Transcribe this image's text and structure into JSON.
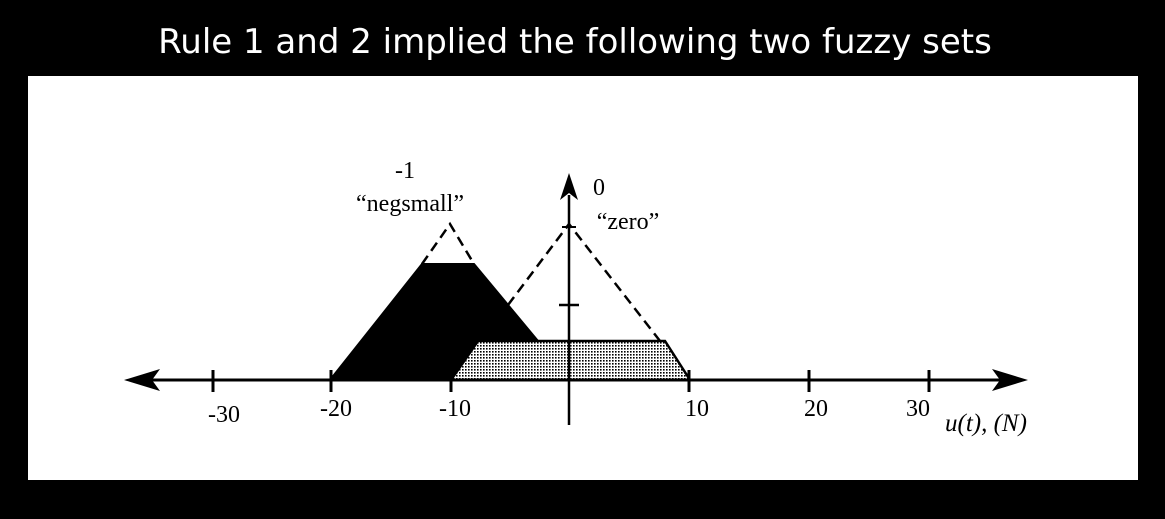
{
  "title": "Rule 1 and 2 implied the following two fuzzy sets",
  "diagram": {
    "axis_label": "u(t), (N)",
    "ticks": [
      "-30",
      "-20",
      "-10",
      "10",
      "20",
      "30"
    ],
    "sets": [
      {
        "index": "-1",
        "name": "“negsmall”",
        "center": -10,
        "clip_level": 0.75,
        "fill": "black"
      },
      {
        "index": "0",
        "name": "“zero”",
        "center": 0,
        "clip_level": 0.25,
        "fill": "dotted"
      }
    ]
  },
  "colors": {
    "background": "#000000",
    "panel": "#ffffff",
    "ink": "#000000"
  }
}
